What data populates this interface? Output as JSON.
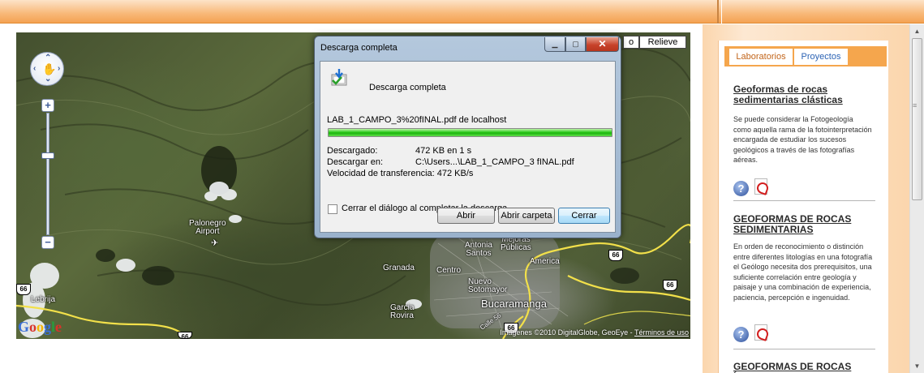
{
  "map": {
    "map_type_partial": "o",
    "map_type_relief": "Relieve",
    "labels": {
      "palonegro": "Palonegro\nAirport",
      "lebrija": "Lebrija",
      "granada": "Granada",
      "centro": "Centro",
      "antonia_santos": "Antonia\nSantos",
      "mejoras_publicas": "Mejoras\nPúblicas",
      "america": "America",
      "nuevo_sotomayor": "Nuevo\nSotomayor",
      "bucaramanga": "Bucaramanga",
      "garcia_rovira": "Garcia\nRovira",
      "calle": "Calle 56"
    },
    "highway_labels": [
      "66",
      "66",
      "66",
      "66",
      "66"
    ],
    "google_logo": "Google",
    "attribution": "Imágenes ©2010 DigitalGlobe, GeoEye - ",
    "terms_link": "Términos de uso"
  },
  "dialog": {
    "title": "Descarga completa",
    "heading": "Descarga completa",
    "filename": "LAB_1_CAMPO_3%20fINAL.pdf de localhost",
    "progress": 1.0,
    "downloaded_label": "Descargado:",
    "downloaded_value": "472 KB en 1 s",
    "saved_to_label": "Descargar en:",
    "saved_to_value": "C:\\Users...\\LAB_1_CAMPO_3 fINAL.pdf",
    "speed_label": "Velocidad de transferencia:",
    "speed_value": "472 KB/s",
    "close_on_complete": "Cerrar el diálogo al completar la descarga",
    "open_button": "Abrir",
    "open_folder_button": "Abrir carpeta",
    "close_button": "Cerrar"
  },
  "sidebar": {
    "tabs": [
      "Laboratorios",
      "Proyectos"
    ],
    "items": [
      {
        "title": "Geoformas de rocas sedimentarias clásticas",
        "text": "Se puede considerar la Fotogeología como aquella rama de la fotointerpretación encargada de estudiar los sucesos geológicos a través de las fotografías aéreas."
      },
      {
        "title": "GEOFORMAS DE ROCAS SEDIMENTARIAS",
        "text": "En orden de reconocimiento o distinción entre diferentes litologías en una fotografía el Geólogo necesita dos prerequisitos, una suficiente correlación entre geología y paisaje y una combinación de experiencia, paciencia, percepción e ingenuidad."
      },
      {
        "title": "GEOFORMAS DE ROCAS ÍGNEAS.",
        "text": ""
      }
    ],
    "help_icon": "help-question-icon",
    "pdf_icon": "pdf-file-icon"
  },
  "colors": {
    "header_orange": "#f4a253",
    "sidebar_orange": "#f5a64d",
    "progress_green": "#1ab30c",
    "link_blue": "#2c63b4"
  }
}
